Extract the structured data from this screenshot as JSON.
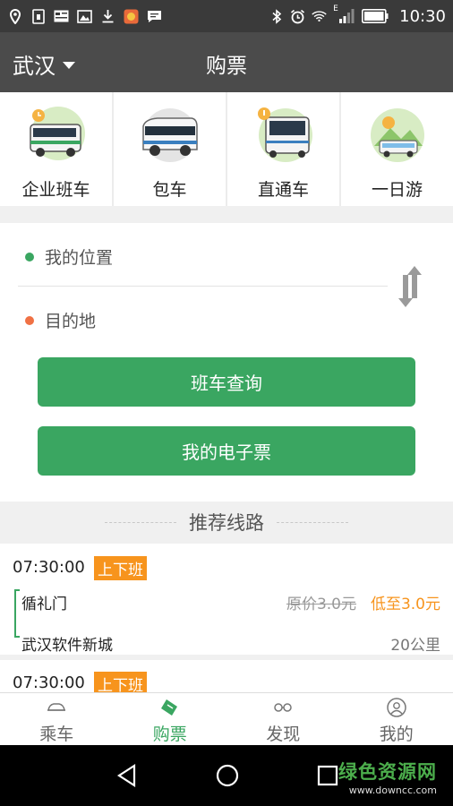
{
  "status_bar": {
    "time": "10:30",
    "left_icons": [
      "location-icon",
      "sim-icon",
      "news-icon",
      "image-icon",
      "download-icon",
      "app-icon",
      "message-icon"
    ],
    "right_icons": [
      "bluetooth-icon",
      "alarm-icon",
      "wifi-icon",
      "signal-icon",
      "battery-icon"
    ],
    "network_label": "E"
  },
  "header": {
    "city": "武汉",
    "title": "购票"
  },
  "categories": [
    {
      "label": "企业班车",
      "icon": "enterprise-bus-icon"
    },
    {
      "label": "包车",
      "icon": "charter-bus-icon"
    },
    {
      "label": "直通车",
      "icon": "express-bus-icon"
    },
    {
      "label": "一日游",
      "icon": "day-tour-icon"
    }
  ],
  "search": {
    "origin": "我的位置",
    "destination": "目的地",
    "query_button": "班车查询",
    "ticket_button": "我的电子票"
  },
  "recommend": {
    "title": "推荐线路"
  },
  "routes": [
    {
      "time": "07:30:00",
      "tag": "上下班",
      "from": "循礼门",
      "to": "武汉软件新城",
      "original_price": "原价3.0元",
      "low_price": "低至3.0元",
      "distance": "20公里"
    },
    {
      "time": "07:30:00",
      "tag": "上下班"
    }
  ],
  "tabs": [
    {
      "label": "乘车",
      "icon": "car-icon",
      "active": false
    },
    {
      "label": "购票",
      "icon": "ticket-icon",
      "active": true
    },
    {
      "label": "发现",
      "icon": "glasses-icon",
      "active": false
    },
    {
      "label": "我的",
      "icon": "user-icon",
      "active": false
    }
  ],
  "watermark": {
    "title": "绿色资源网",
    "url": "www.downcc.com"
  },
  "colors": {
    "accent_green": "#3aa661",
    "tag_orange": "#f7941d",
    "header_bg": "#4b4b4b",
    "status_bg": "#3a3a3a"
  }
}
